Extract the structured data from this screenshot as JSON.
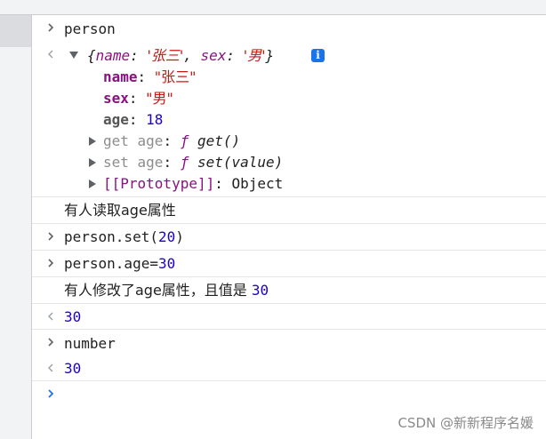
{
  "console": {
    "cmd_person": "person",
    "obj_preview_open": "{",
    "obj_preview_name_key": "name",
    "obj_preview_name_val": "'张三'",
    "obj_preview_sex_key": "sex",
    "obj_preview_sex_val": "'男'",
    "obj_preview_close": "}",
    "obj_preview_colon": ": ",
    "obj_preview_comma": ", ",
    "info_badge": "i",
    "prop_name_key": "name",
    "prop_name_val": "\"张三\"",
    "prop_sex_key": "sex",
    "prop_sex_val": "\"男\"",
    "prop_age_key": "age",
    "prop_age_val": "18",
    "colon": ": ",
    "getter_key": "get age",
    "getter_f": "ƒ",
    "getter_val": "get()",
    "setter_key": "set age",
    "setter_f": "ƒ",
    "setter_val": "set(value)",
    "proto_key": "[[Prototype]]",
    "proto_val": "Object",
    "log_read": "有人读取age属性",
    "cmd_set_prefix": "person.set(",
    "cmd_set_arg": "20",
    "cmd_set_suffix": ")",
    "cmd_assign_prefix": "person.age=",
    "cmd_assign_val": "30",
    "log_modify_text": "有人修改了age属性，且值是 ",
    "log_modify_val": "30",
    "result_30": "30",
    "cmd_number": "number",
    "result_number": "30"
  },
  "watermark": "CSDN @新新程序名媛",
  "colors": {
    "prompt_chevron": "#5f6368",
    "active_prompt": "#1a73e8",
    "string": "#c41a16",
    "number": "#1c00cf",
    "key": "#881280"
  }
}
